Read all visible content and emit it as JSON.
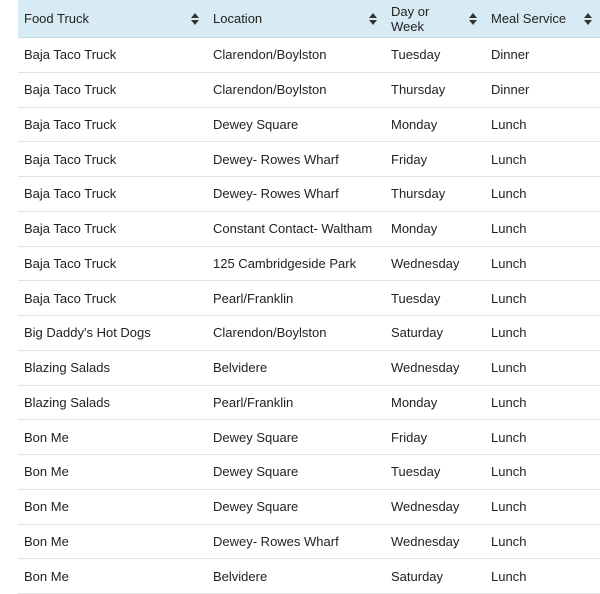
{
  "table": {
    "columns": [
      "Food Truck",
      "Location",
      "Day or Week",
      "Meal Service"
    ],
    "rows": [
      [
        "Baja Taco Truck",
        "Clarendon/Boylston",
        "Tuesday",
        "Dinner"
      ],
      [
        "Baja Taco Truck",
        "Clarendon/Boylston",
        "Thursday",
        "Dinner"
      ],
      [
        "Baja Taco Truck",
        "Dewey Square",
        "Monday",
        "Lunch"
      ],
      [
        "Baja Taco Truck",
        "Dewey- Rowes Wharf",
        "Friday",
        "Lunch"
      ],
      [
        "Baja Taco Truck",
        "Dewey- Rowes Wharf",
        "Thursday",
        "Lunch"
      ],
      [
        "Baja Taco Truck",
        "Constant Contact- Waltham",
        "Monday",
        "Lunch"
      ],
      [
        "Baja Taco Truck",
        "125 Cambridgeside Park",
        "Wednesday",
        "Lunch"
      ],
      [
        "Baja Taco Truck",
        "Pearl/Franklin",
        "Tuesday",
        "Lunch"
      ],
      [
        "Big Daddy's Hot Dogs",
        "Clarendon/Boylston",
        "Saturday",
        "Lunch"
      ],
      [
        "Blazing Salads",
        "Belvidere",
        "Wednesday",
        "Lunch"
      ],
      [
        "Blazing Salads",
        "Pearl/Franklin",
        "Monday",
        "Lunch"
      ],
      [
        "Bon Me",
        "Dewey Square",
        "Friday",
        "Lunch"
      ],
      [
        "Bon Me",
        "Dewey Square",
        "Tuesday",
        "Lunch"
      ],
      [
        "Bon Me",
        "Dewey Square",
        "Wednesday",
        "Lunch"
      ],
      [
        "Bon Me",
        "Dewey- Rowes Wharf",
        "Wednesday",
        "Lunch"
      ],
      [
        "Bon Me",
        "Belvidere",
        "Saturday",
        "Lunch"
      ]
    ]
  },
  "icons": {
    "sort": "sort-arrows-icon"
  },
  "colors": {
    "header_bg": "#d7ebf5",
    "row_border": "#e3e3e3",
    "text": "#222222"
  }
}
